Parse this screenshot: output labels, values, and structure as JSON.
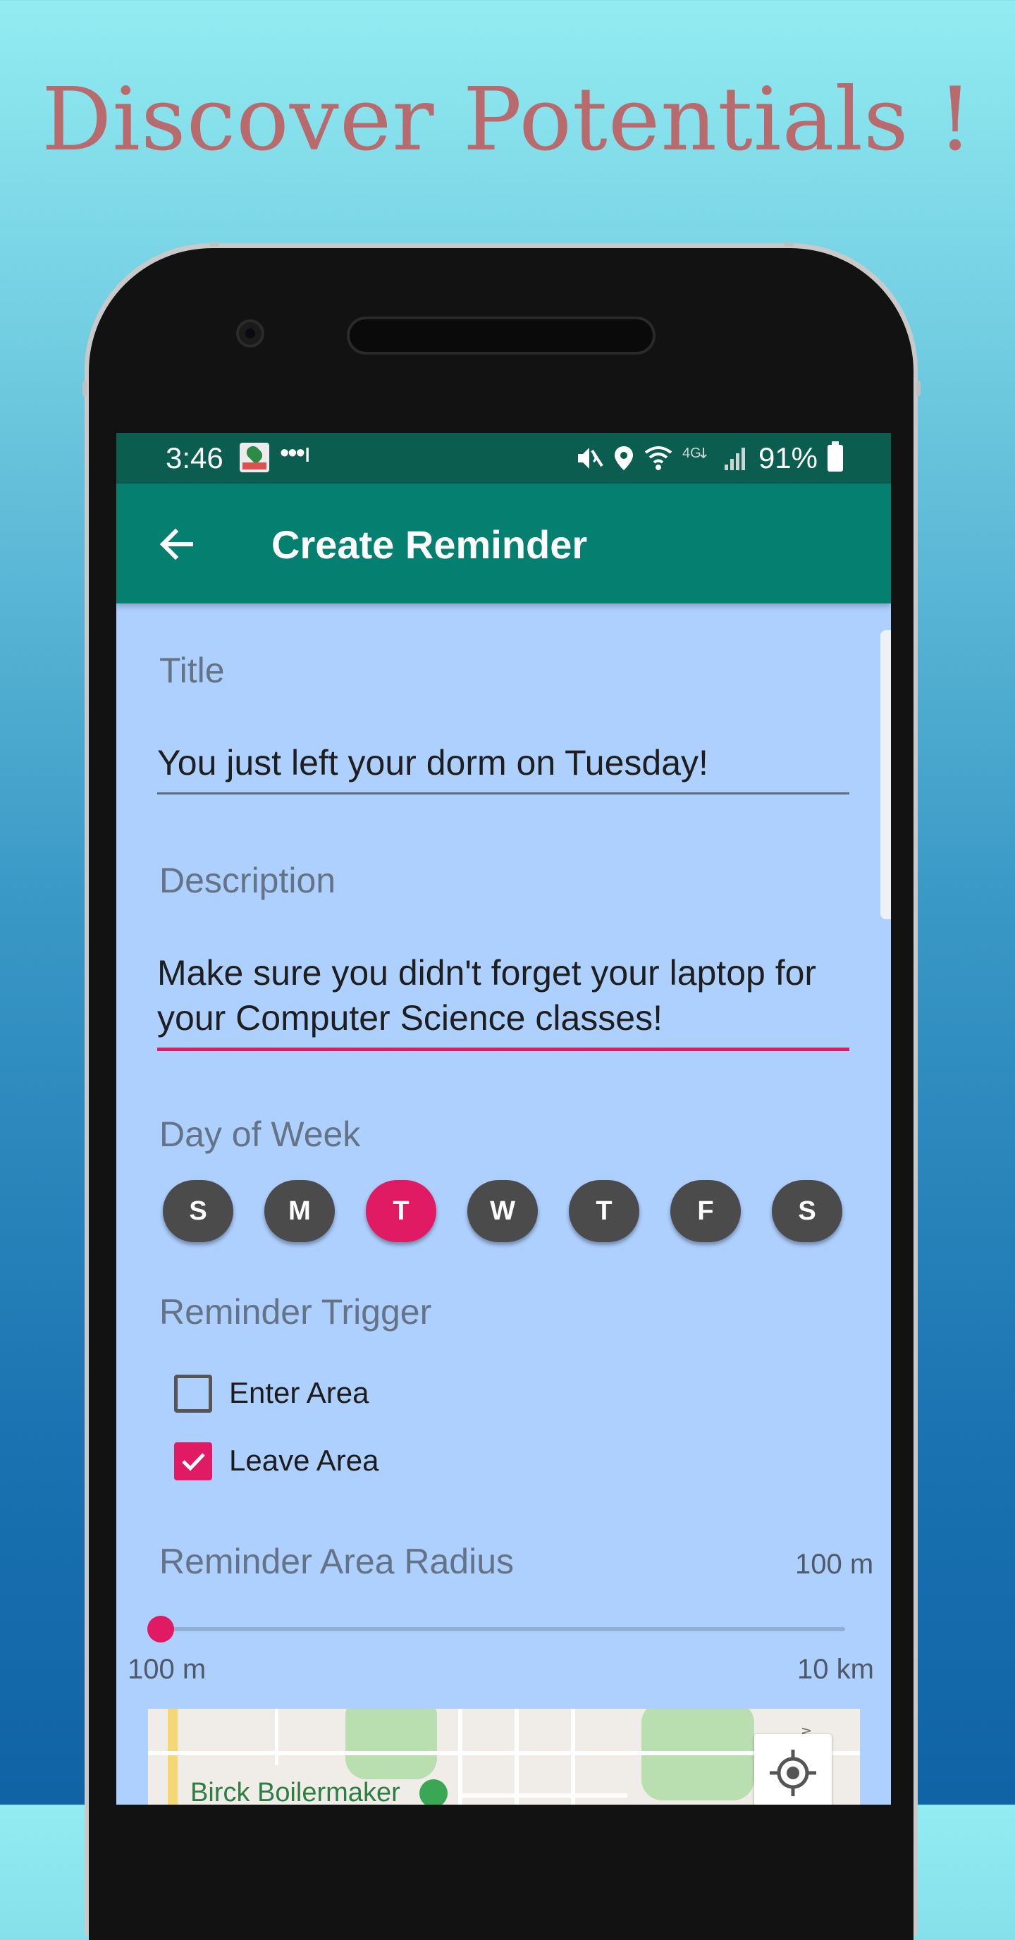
{
  "promo": {
    "headline": "Discover Potentials !"
  },
  "status_bar": {
    "time": "3:46",
    "dots": "•••ı",
    "battery": "91%",
    "icons": [
      "app-notification-icon",
      "mute-icon",
      "location-icon",
      "wifi-icon",
      "4g-icon",
      "signal-icon",
      "battery-icon"
    ]
  },
  "app_bar": {
    "title": "Create Reminder",
    "back_icon": "arrow-left-icon"
  },
  "form": {
    "title_label": "Title",
    "title_value": "You just left your dorm on Tuesday!",
    "description_label": "Description",
    "description_value": "Make sure you didn't forget your laptop for your Computer Science classes!",
    "day_label": "Day of Week",
    "days": [
      {
        "letter": "S",
        "selected": false
      },
      {
        "letter": "M",
        "selected": false
      },
      {
        "letter": "T",
        "selected": true
      },
      {
        "letter": "W",
        "selected": false
      },
      {
        "letter": "T",
        "selected": false
      },
      {
        "letter": "F",
        "selected": false
      },
      {
        "letter": "S",
        "selected": false
      }
    ],
    "trigger_label": "Reminder Trigger",
    "enter_area": {
      "label": "Enter Area",
      "checked": false
    },
    "leave_area": {
      "label": "Leave Area",
      "checked": true
    },
    "radius_label": "Reminder Area Radius",
    "radius_value": "100 m",
    "slider_min": "100 m",
    "slider_max": "10 km",
    "slider_fraction": 0.0
  },
  "map": {
    "place_label": "Birck Boilermaker",
    "road_label": "y Hollow Rd"
  },
  "colors": {
    "accent": "#e01a63",
    "toolbar": "#057f70",
    "status_bar": "#0b5e4f",
    "screen_bg": "#aed0ff",
    "headline": "#b86a6c"
  }
}
